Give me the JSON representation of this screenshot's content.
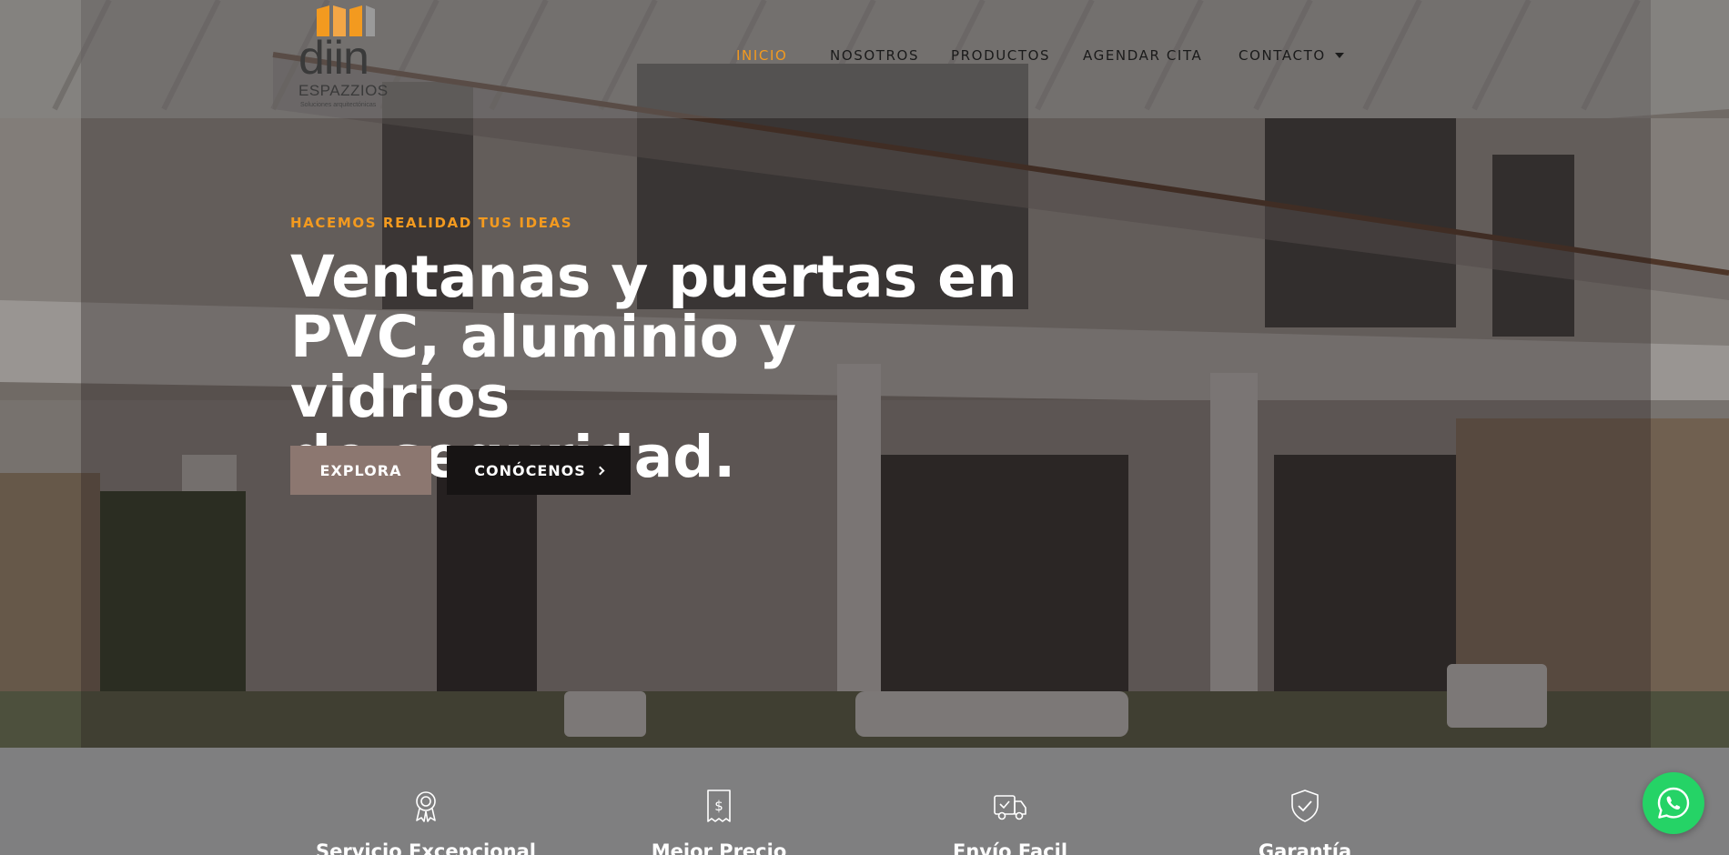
{
  "brand": {
    "name": "diin",
    "subname": "ESPAZZIOS",
    "tagline": "Soluciones arquitectónicas"
  },
  "nav": {
    "items": [
      {
        "label": "INICIO",
        "active": true
      },
      {
        "label": "NOSOTROS",
        "active": false
      },
      {
        "label": "PRODUCTOS",
        "active": false
      },
      {
        "label": "AGENDAR CITA",
        "active": false
      },
      {
        "label": "CONTACTO",
        "active": false,
        "has_dropdown": true
      }
    ]
  },
  "hero": {
    "eyebrow": "HACEMOS REALIDAD TUS IDEAS",
    "headline_line1": "Ventanas y puertas en",
    "headline_line2": "PVC, aluminio y vidrios",
    "headline_line3": "de seguridad.",
    "primary_button": "EXPLORA",
    "secondary_button": "CONÓCENOS"
  },
  "features": [
    {
      "title": "Servicio Excepcional",
      "icon": "award-ribbon-icon"
    },
    {
      "title": "Mejor Precio",
      "icon": "price-tag-dollar-icon"
    },
    {
      "title": "Envío Facil",
      "icon": "delivery-truck-icon"
    },
    {
      "title": "Garantía",
      "icon": "shield-check-icon"
    }
  ],
  "colors": {
    "accent": "#f39a1f",
    "explora_button": "#8c7770",
    "conocenos_button": "#171414",
    "features_bg": "#7f7f80",
    "whatsapp": "#25d366"
  },
  "whatsapp": {
    "icon": "whatsapp-icon"
  }
}
